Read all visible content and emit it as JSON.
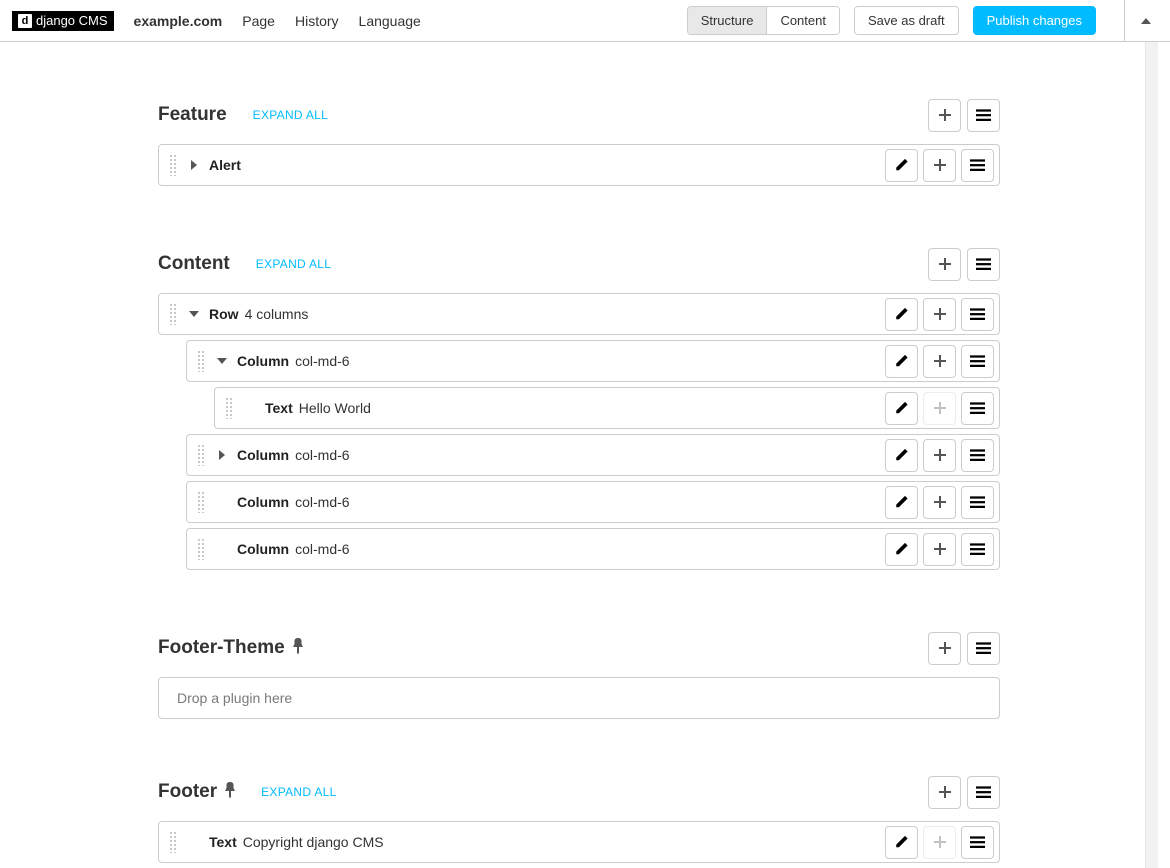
{
  "toolbar": {
    "logo_text": "django CMS",
    "site_name": "example.com",
    "menu": {
      "page": "Page",
      "history": "History",
      "language": "Language"
    },
    "view_toggle": {
      "structure": "Structure",
      "content": "Content"
    },
    "save_draft": "Save as draft",
    "publish": "Publish changes"
  },
  "expand_all_label": "Expand All",
  "placeholders": [
    {
      "name": "Feature",
      "pinned": false,
      "show_expand": true,
      "plugins": [
        {
          "type": "Alert",
          "desc": "",
          "collapse": "right",
          "indent": 0,
          "edit": true,
          "add": true
        }
      ]
    },
    {
      "name": "Content",
      "pinned": false,
      "show_expand": true,
      "plugins": [
        {
          "type": "Row",
          "desc": "4 columns",
          "collapse": "down",
          "indent": 0,
          "edit": true,
          "add": true
        },
        {
          "type": "Column",
          "desc": "col-md-6",
          "collapse": "down",
          "indent": 1,
          "edit": true,
          "add": true
        },
        {
          "type": "Text",
          "desc": "Hello World",
          "collapse": "none",
          "indent": 2,
          "edit": true,
          "add": false
        },
        {
          "type": "Column",
          "desc": "col-md-6",
          "collapse": "right",
          "indent": 1,
          "edit": true,
          "add": true
        },
        {
          "type": "Column",
          "desc": "col-md-6",
          "collapse": "none",
          "indent": 1,
          "edit": true,
          "add": true
        },
        {
          "type": "Column",
          "desc": "col-md-6",
          "collapse": "none",
          "indent": 1,
          "edit": true,
          "add": true
        }
      ]
    },
    {
      "name": "Footer-Theme",
      "pinned": true,
      "show_expand": false,
      "drop_hint": "Drop a plugin here",
      "plugins": []
    },
    {
      "name": "Footer",
      "pinned": true,
      "show_expand": true,
      "plugins": [
        {
          "type": "Text",
          "desc": "Copyright django CMS",
          "collapse": "none",
          "indent": 0,
          "edit": true,
          "add": false
        }
      ]
    }
  ]
}
